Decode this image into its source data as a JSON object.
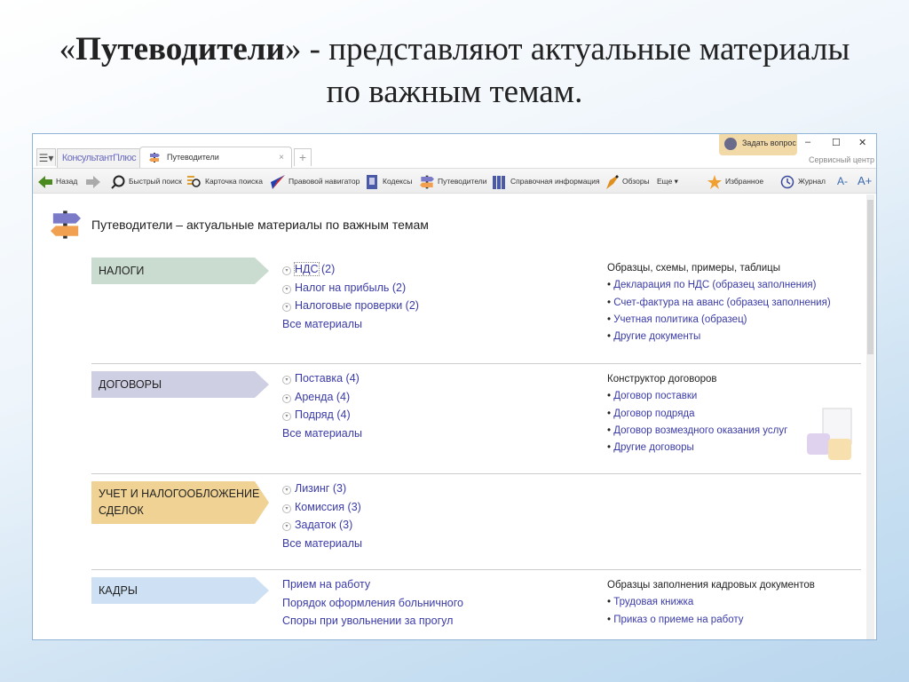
{
  "slide": {
    "title_quote_open": "«",
    "title_bold": "Путеводители",
    "title_rest": "» - представляют актуальные материалы",
    "title_line2": "по важным темам."
  },
  "window": {
    "logo": "КонсультантПлюс",
    "tab_label": "Путеводители",
    "tab_close": "×",
    "tab_new": "+",
    "ask_label": "Задать вопрос",
    "minimize": "–",
    "maximize": "☐",
    "close": "✕",
    "service_center": "Сервисный центр",
    "toolbar": {
      "back": "Назад",
      "quick_search": "Быстрый поиск",
      "search_card": "Карточка поиска",
      "legal_navigator": "Правовой навигатор",
      "codes": "Кодексы",
      "guides": "Путеводители",
      "reference": "Справочная информация",
      "reviews": "Обзоры",
      "more": "Еще",
      "favorites": "Избранное",
      "journal": "Журнал",
      "font_minus": "A-",
      "font_plus": "A+"
    }
  },
  "page": {
    "heading": "Путеводители – актуальные материалы по важным темам"
  },
  "sections": [
    {
      "category": "НАЛОГИ",
      "color": "#c9dccf",
      "links": [
        {
          "label": "НДС",
          "count": "(2)",
          "expand": true
        },
        {
          "label": "Налог на прибыль",
          "count": "(2)",
          "expand": true
        },
        {
          "label": "Налоговые проверки",
          "count": "(2)",
          "expand": true
        },
        {
          "label": "Все материалы",
          "count": "",
          "expand": false
        }
      ],
      "right_title": "Образцы, схемы, примеры, таблицы",
      "right_links": [
        "Декларация по НДС (образец заполнения)",
        "Счет-фактура на аванс (образец заполнения)",
        "Учетная политика (образец)",
        "Другие документы"
      ]
    },
    {
      "category": "ДОГОВОРЫ",
      "color": "#cfcfe3",
      "links": [
        {
          "label": "Поставка",
          "count": "(4)",
          "expand": true
        },
        {
          "label": "Аренда",
          "count": "(4)",
          "expand": true
        },
        {
          "label": "Подряд",
          "count": "(4)",
          "expand": true
        },
        {
          "label": "Все материалы",
          "count": "",
          "expand": false
        }
      ],
      "right_title": "Конструктор договоров",
      "right_links": [
        "Договор поставки",
        "Договор подряда",
        "Договор возмездного оказания услуг",
        "Другие договоры"
      ]
    },
    {
      "category": "УЧЕТ И НАЛОГООБЛОЖЕНИЕ СДЕЛОК",
      "color": "#f0d394",
      "links": [
        {
          "label": "Лизинг",
          "count": "(3)",
          "expand": true
        },
        {
          "label": "Комиссия",
          "count": "(3)",
          "expand": true
        },
        {
          "label": "Задаток",
          "count": "(3)",
          "expand": true
        },
        {
          "label": "Все материалы",
          "count": "",
          "expand": false
        }
      ],
      "right_title": "",
      "right_links": []
    },
    {
      "category": "КАДРЫ",
      "color": "#cde0f4",
      "links": [
        {
          "label": "Прием на работу",
          "count": "",
          "expand": false
        },
        {
          "label": "Порядок оформления больничного",
          "count": "",
          "expand": false
        },
        {
          "label": "Споры при увольнении за прогул",
          "count": "",
          "expand": false
        }
      ],
      "right_title": "Образцы заполнения кадровых документов",
      "right_links": [
        "Трудовая книжка",
        "Приказ о приеме на работу"
      ]
    }
  ]
}
